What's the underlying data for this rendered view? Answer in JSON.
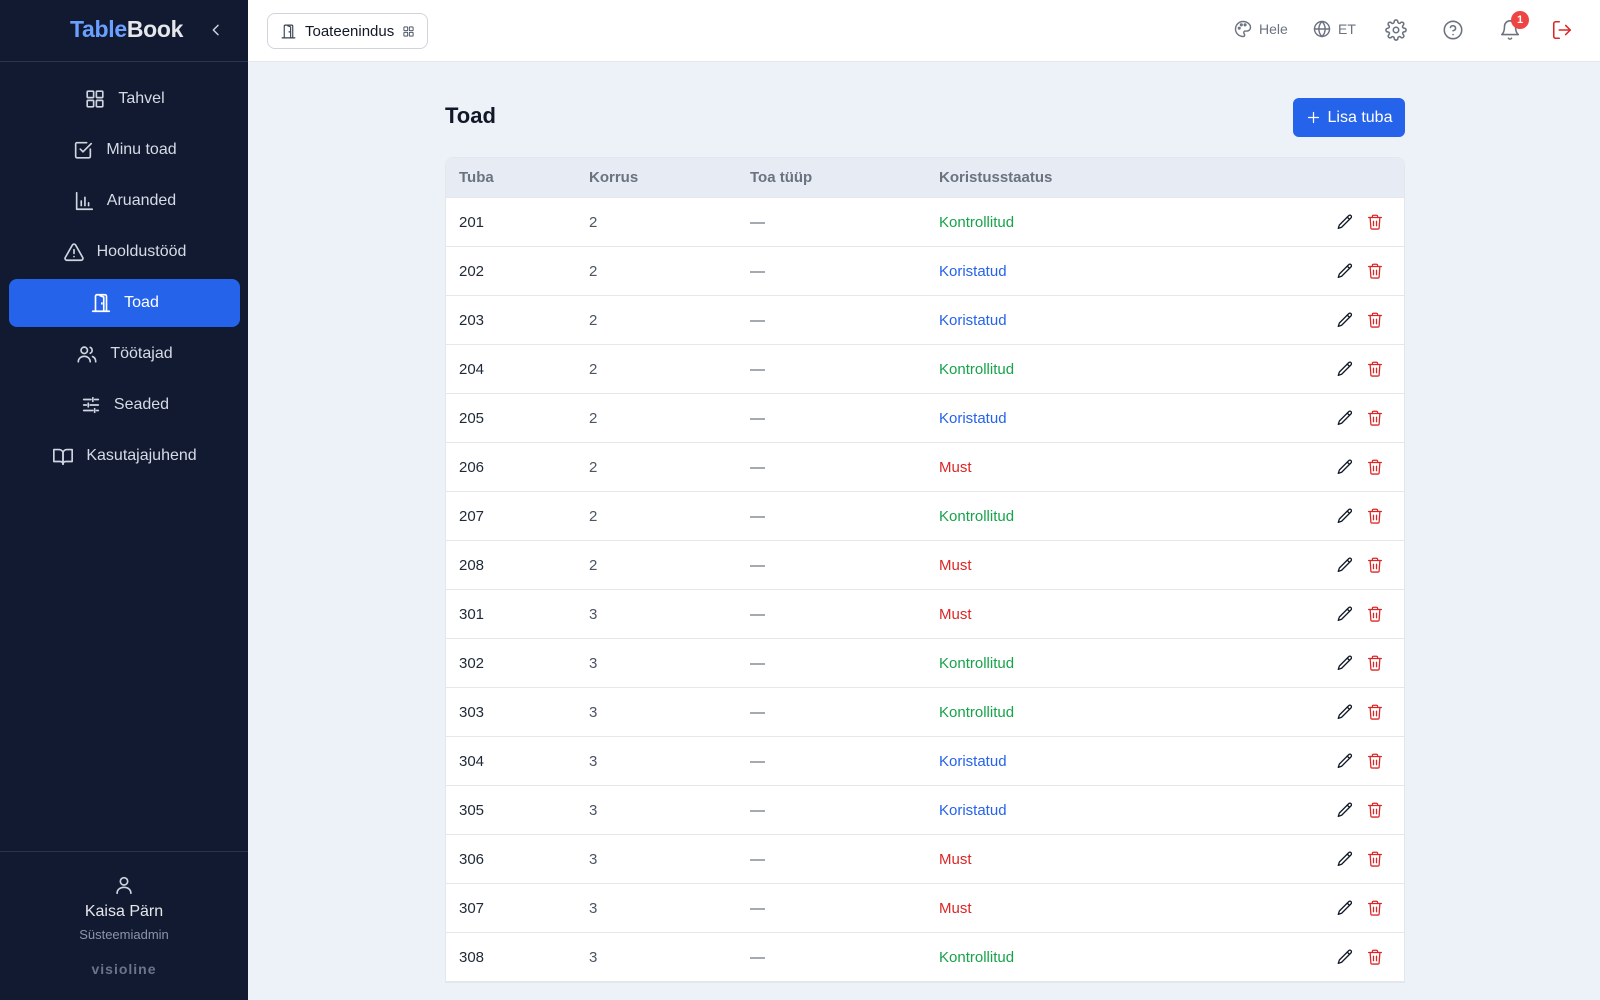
{
  "app": {
    "logo_part1": "Table",
    "logo_part2": "Book"
  },
  "sidebar": {
    "items": [
      {
        "label": "Tahvel",
        "icon": "grid-icon",
        "active": false
      },
      {
        "label": "Minu toad",
        "icon": "check-square-icon",
        "active": false
      },
      {
        "label": "Aruanded",
        "icon": "bar-chart-icon",
        "active": false
      },
      {
        "label": "Hooldustööd",
        "icon": "warning-triangle-icon",
        "active": false
      },
      {
        "label": "Toad",
        "icon": "door-icon",
        "active": true
      },
      {
        "label": "Töötajad",
        "icon": "users-icon",
        "active": false
      },
      {
        "label": "Seaded",
        "icon": "sliders-icon",
        "active": false
      },
      {
        "label": "Kasutajajuhend",
        "icon": "book-icon",
        "active": false
      }
    ],
    "user": {
      "name": "Kaisa Pärn",
      "role": "Süsteemiadmin"
    },
    "brand": "visioline"
  },
  "topbar": {
    "module_label": "Toateenindus",
    "theme_label": "Hele",
    "language_label": "ET",
    "notification_count": "1"
  },
  "main": {
    "title": "Toad",
    "add_button_label": "Lisa tuba",
    "columns": [
      "Tuba",
      "Korrus",
      "Toa tüüp",
      "Koristusstaatus"
    ],
    "rows": [
      {
        "room": "201",
        "floor": "2",
        "type": "—",
        "status": "Kontrollitud",
        "status_key": "kontrollitud"
      },
      {
        "room": "202",
        "floor": "2",
        "type": "—",
        "status": "Koristatud",
        "status_key": "koristatud"
      },
      {
        "room": "203",
        "floor": "2",
        "type": "—",
        "status": "Koristatud",
        "status_key": "koristatud"
      },
      {
        "room": "204",
        "floor": "2",
        "type": "—",
        "status": "Kontrollitud",
        "status_key": "kontrollitud"
      },
      {
        "room": "205",
        "floor": "2",
        "type": "—",
        "status": "Koristatud",
        "status_key": "koristatud"
      },
      {
        "room": "206",
        "floor": "2",
        "type": "—",
        "status": "Must",
        "status_key": "must"
      },
      {
        "room": "207",
        "floor": "2",
        "type": "—",
        "status": "Kontrollitud",
        "status_key": "kontrollitud"
      },
      {
        "room": "208",
        "floor": "2",
        "type": "—",
        "status": "Must",
        "status_key": "must"
      },
      {
        "room": "301",
        "floor": "3",
        "type": "—",
        "status": "Must",
        "status_key": "must"
      },
      {
        "room": "302",
        "floor": "3",
        "type": "—",
        "status": "Kontrollitud",
        "status_key": "kontrollitud"
      },
      {
        "room": "303",
        "floor": "3",
        "type": "—",
        "status": "Kontrollitud",
        "status_key": "kontrollitud"
      },
      {
        "room": "304",
        "floor": "3",
        "type": "—",
        "status": "Koristatud",
        "status_key": "koristatud"
      },
      {
        "room": "305",
        "floor": "3",
        "type": "—",
        "status": "Koristatud",
        "status_key": "koristatud"
      },
      {
        "room": "306",
        "floor": "3",
        "type": "—",
        "status": "Must",
        "status_key": "must"
      },
      {
        "room": "307",
        "floor": "3",
        "type": "—",
        "status": "Must",
        "status_key": "must"
      },
      {
        "room": "308",
        "floor": "3",
        "type": "—",
        "status": "Kontrollitud",
        "status_key": "kontrollitud"
      }
    ]
  },
  "colors": {
    "sidebar_bg": "#111a30",
    "accent": "#2563eb",
    "kontrollitud": "#16a34a",
    "koristatud": "#2563eb",
    "must": "#dc2626"
  }
}
